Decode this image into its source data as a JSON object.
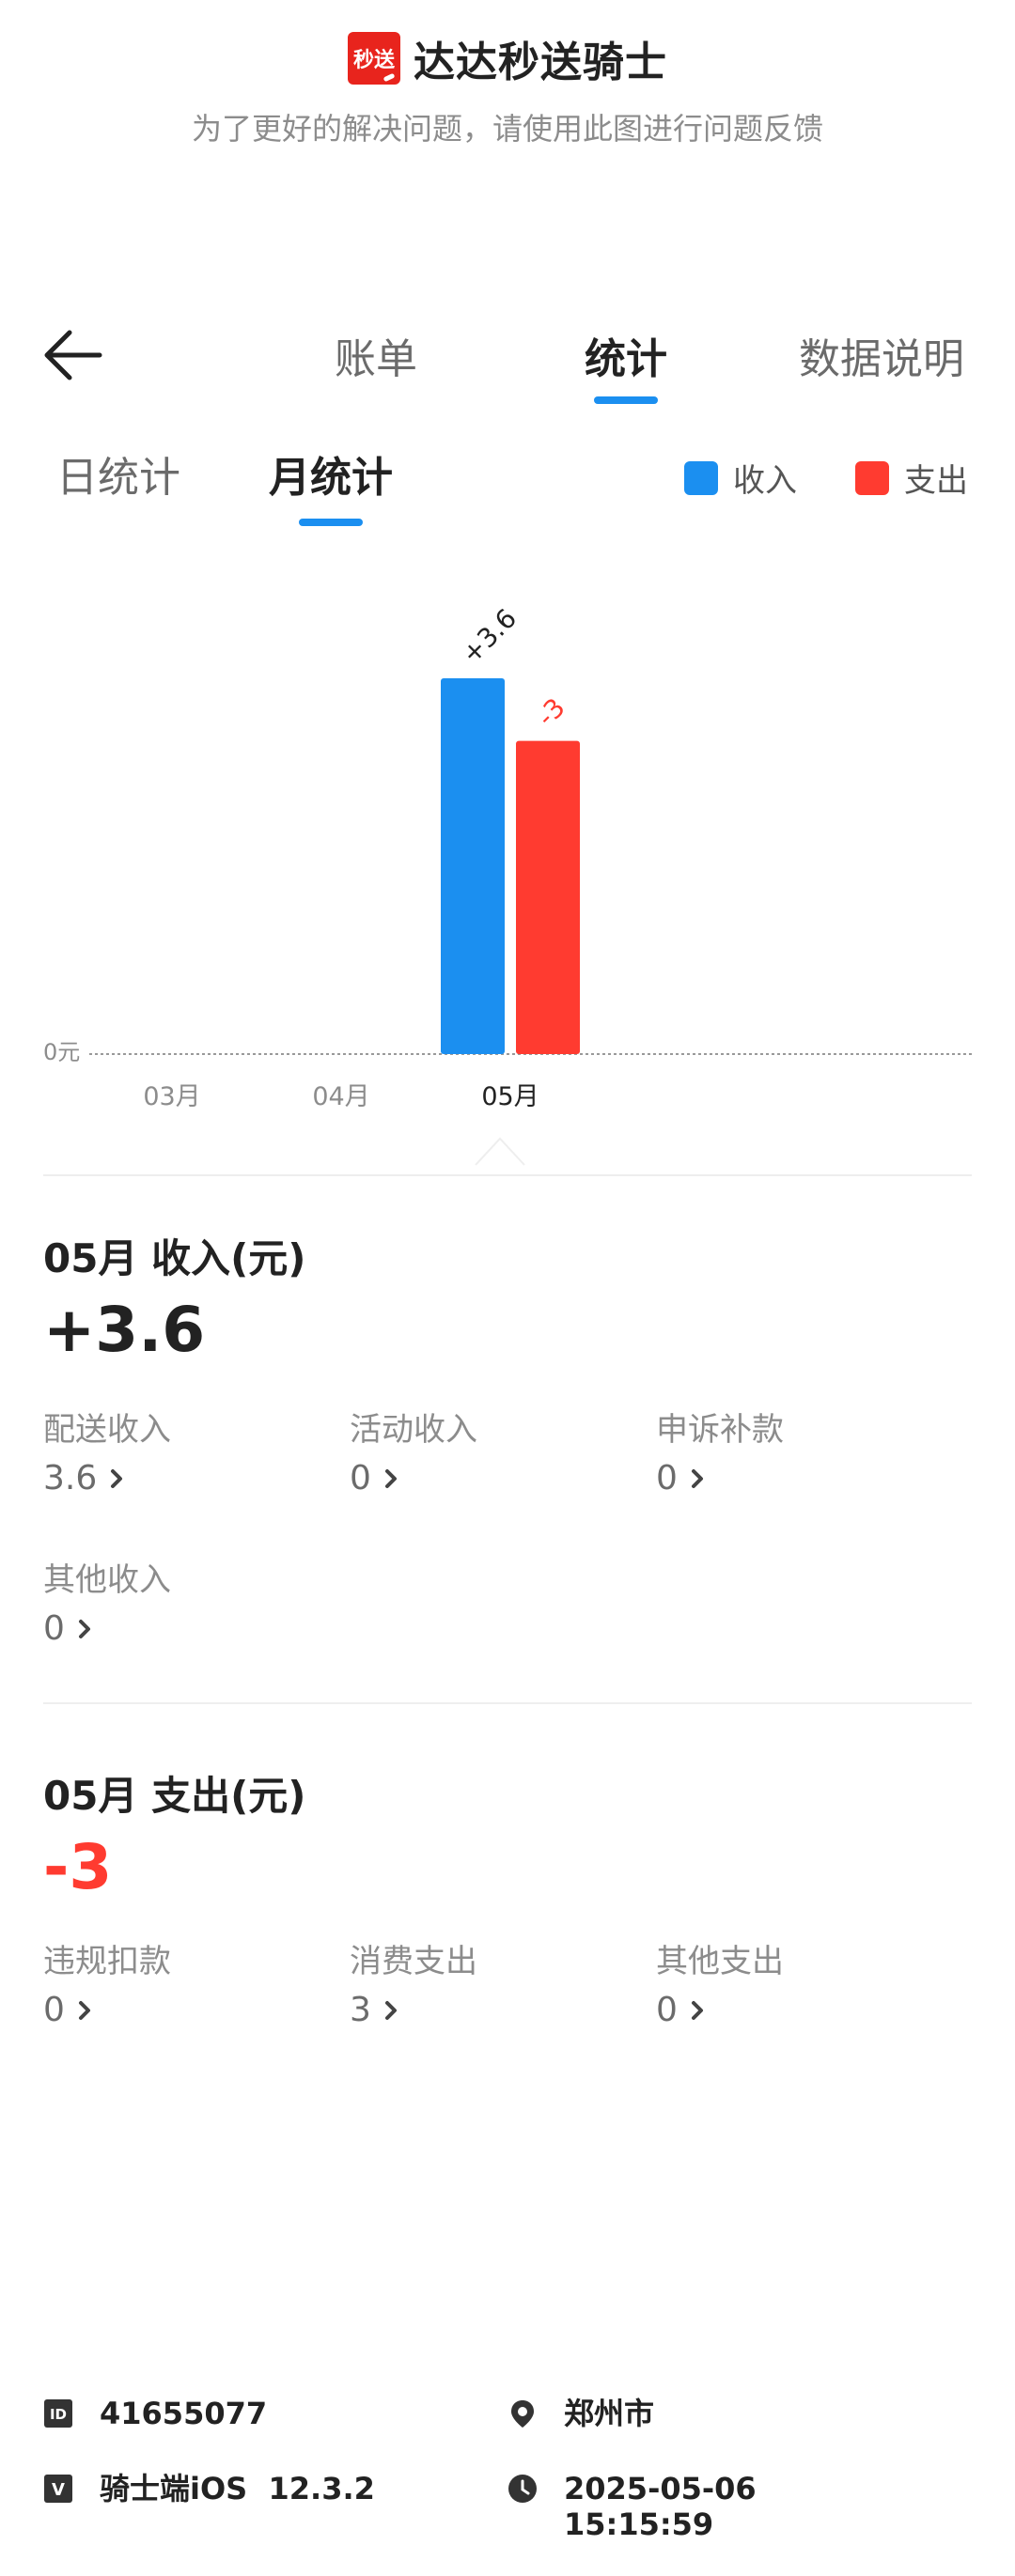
{
  "header": {
    "logo_text": "秒送",
    "app_name": "达达秒送骑士",
    "hint": "为了更好的解决问题，请使用此图进行问题反馈"
  },
  "nav": {
    "tabs": [
      "账单",
      "统计",
      "数据说明"
    ],
    "active_tab": "统计"
  },
  "subnav": {
    "tabs": [
      "日统计",
      "月统计"
    ],
    "active_tab": "月统计",
    "legend": {
      "income": "收入",
      "expense": "支出"
    }
  },
  "colors": {
    "income": "#1b8ff0",
    "expense": "#ff3b30",
    "accent": "#1b8ff0"
  },
  "chart_data": {
    "type": "bar",
    "categories": [
      "03月",
      "04月",
      "05月"
    ],
    "selected_category": "05月",
    "series": [
      {
        "name": "收入",
        "values": [
          0,
          0,
          3.6
        ],
        "labels": [
          "",
          "",
          "+3.6"
        ],
        "color": "#1b8ff0"
      },
      {
        "name": "支出",
        "values": [
          0,
          0,
          3
        ],
        "labels": [
          "",
          "",
          "-3"
        ],
        "color": "#ff3b30"
      }
    ],
    "zero_label": "0元",
    "grid": false
  },
  "income": {
    "title": "05月  收入(元)",
    "total": "+3.6",
    "items": [
      {
        "label": "配送收入",
        "value": "3.6"
      },
      {
        "label": "活动收入",
        "value": "0"
      },
      {
        "label": "申诉补款",
        "value": "0"
      },
      {
        "label": "其他收入",
        "value": "0"
      }
    ]
  },
  "expense": {
    "title": "05月  支出(元)",
    "total": "-3",
    "items": [
      {
        "label": "违规扣款",
        "value": "0"
      },
      {
        "label": "消费支出",
        "value": "3"
      },
      {
        "label": "其他支出",
        "value": "0"
      }
    ]
  },
  "footer": {
    "id_icon_text": "ID",
    "id": "41655077",
    "version_icon_text": "V",
    "version": "骑士端iOS  12.3.2",
    "city": "郑州市",
    "date": "2025-05-06",
    "time": "15:15:59"
  }
}
